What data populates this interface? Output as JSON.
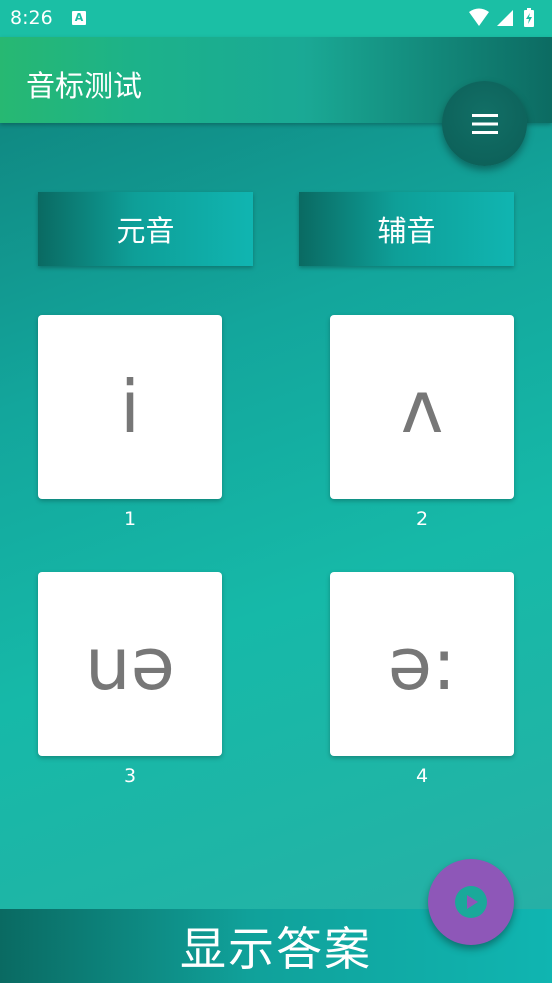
{
  "status_bar": {
    "time": "8:26",
    "notification_badge": "A"
  },
  "app_bar": {
    "title": "音标测试",
    "menu_icon": "hamburger-icon"
  },
  "tabs": [
    {
      "label": "元音"
    },
    {
      "label": "辅音"
    }
  ],
  "cards": [
    {
      "symbol": "i",
      "number": "1"
    },
    {
      "symbol": "ʌ",
      "number": "2"
    },
    {
      "symbol": "uə",
      "number": "3"
    },
    {
      "symbol": "ə:",
      "number": "4"
    }
  ],
  "bottom_button": {
    "label": "显示答案"
  },
  "play_fab": {
    "icon": "play-icon"
  },
  "colors": {
    "play_fab": "#8e57b8",
    "menu_fab": "#0b5d56",
    "status_bar": "#1bbfa5"
  }
}
